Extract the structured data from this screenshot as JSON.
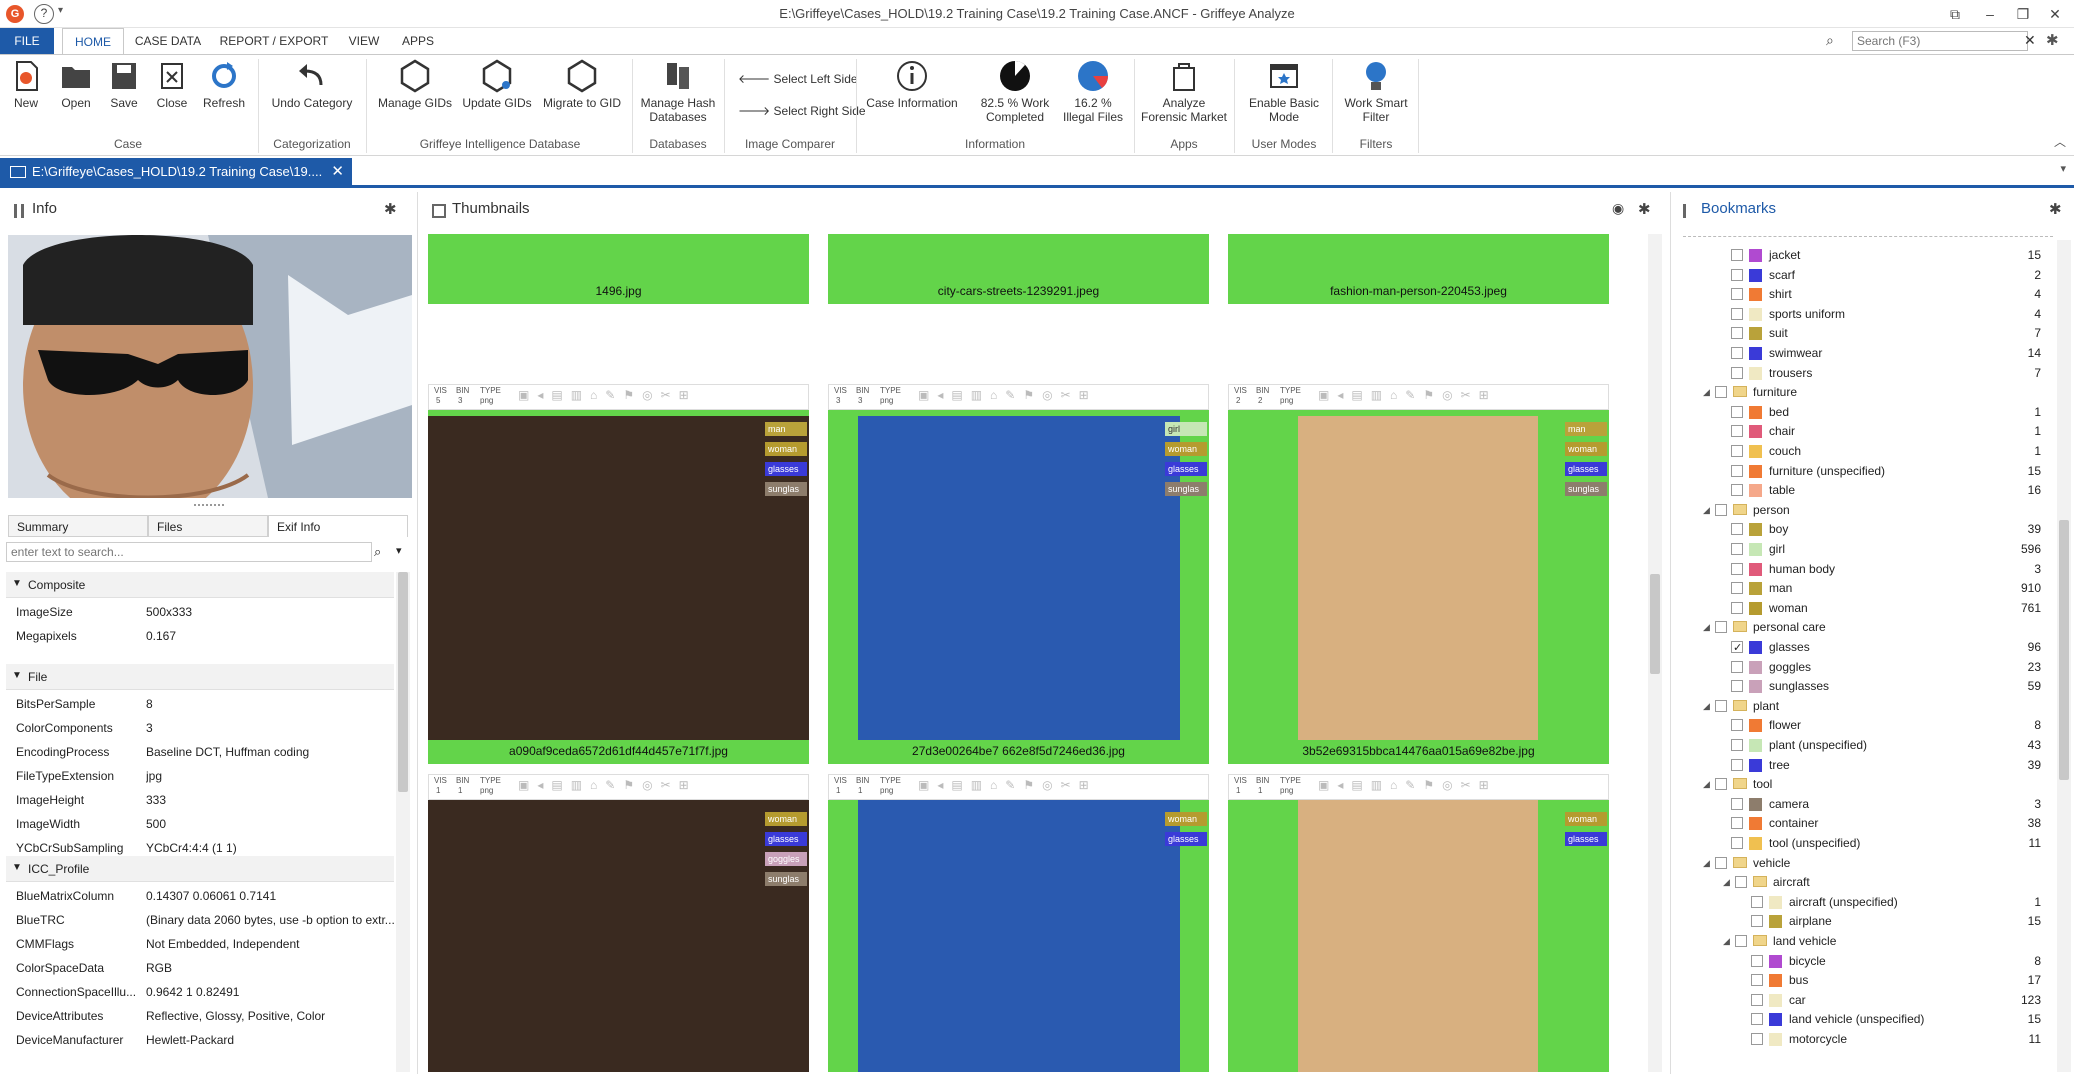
{
  "window": {
    "title": "E:\\Griffeye\\Cases_HOLD\\19.2 Training Case\\19.2 Training Case.ANCF - Griffeye Analyze"
  },
  "menu": {
    "tabs": [
      {
        "label": "FILE"
      },
      {
        "label": "HOME"
      },
      {
        "label": "CASE DATA"
      },
      {
        "label": "REPORT / EXPORT"
      },
      {
        "label": "VIEW"
      },
      {
        "label": "APPS"
      }
    ],
    "search_placeholder": "Search (F3)"
  },
  "ribbon": {
    "buttons": {
      "new": "New",
      "open": "Open",
      "save": "Save",
      "close": "Close",
      "refresh": "Refresh",
      "undo": "Undo Category",
      "manage_gids": "Manage GIDs",
      "update_gids": "Update GIDs",
      "migrate": "Migrate to GID",
      "manage_hash": "Manage Hash Databases",
      "select_left": "Select Left Side",
      "select_right": "Select Right Side",
      "case_info": "Case Information",
      "work_completed": "82.5 % Work Completed",
      "illegal_files": "16.2 % Illegal Files",
      "analyze_forensic": "Analyze Forensic Market",
      "enable_basic": "Enable Basic Mode",
      "work_smart": "Work Smart Filter"
    },
    "groups": {
      "case": "Case",
      "categorization": "Categorization",
      "gid": "Griffeye Intelligence Database",
      "databases": "Databases",
      "comparer": "Image Comparer",
      "information": "Information",
      "apps": "Apps",
      "user_modes": "User Modes",
      "filters": "Filters"
    }
  },
  "doc_tab": {
    "label": "E:\\Griffeye\\Cases_HOLD\\19.2 Training Case\\19...."
  },
  "info": {
    "title": "Info",
    "tabs": {
      "summary": "Summary",
      "files": "Files",
      "exif": "Exif Info"
    },
    "search_placeholder": "enter text to search...",
    "composite_label": "Composite",
    "composite": [
      {
        "k": "ImageSize",
        "v": "500x333"
      },
      {
        "k": "Megapixels",
        "v": "0.167"
      }
    ],
    "file_label": "File",
    "file": [
      {
        "k": "BitsPerSample",
        "v": "8"
      },
      {
        "k": "ColorComponents",
        "v": "3"
      },
      {
        "k": "EncodingProcess",
        "v": "Baseline DCT, Huffman coding"
      },
      {
        "k": "FileTypeExtension",
        "v": "jpg"
      },
      {
        "k": "ImageHeight",
        "v": "333"
      },
      {
        "k": "ImageWidth",
        "v": "500"
      },
      {
        "k": "YCbCrSubSampling",
        "v": "YCbCr4:4:4 (1 1)"
      }
    ],
    "icc_label": "ICC_Profile",
    "icc": [
      {
        "k": "BlueMatrixColumn",
        "v": "0.14307 0.06061 0.7141"
      },
      {
        "k": "BlueTRC",
        "v": "(Binary data 2060 bytes, use -b option to extr..."
      },
      {
        "k": "CMMFlags",
        "v": "Not Embedded, Independent"
      },
      {
        "k": "ColorSpaceData",
        "v": "RGB"
      },
      {
        "k": "ConnectionSpaceIllu...",
        "v": "0.9642 1 0.82491"
      },
      {
        "k": "DeviceAttributes",
        "v": "Reflective, Glossy, Positive, Color"
      },
      {
        "k": "DeviceManufacturer",
        "v": "Hewlett-Packard"
      }
    ]
  },
  "thumbs": {
    "title": "Thumbnails",
    "items": [
      {
        "name": "1496.jpg",
        "tags": []
      },
      {
        "name": "city-cars-streets-1239291.jpeg",
        "tags": []
      },
      {
        "name": "fashion-man-person-220453.jpeg",
        "tags": []
      },
      {
        "name": "a090af9ceda6572d61df44d457e71f7f.jpg",
        "vis": "5",
        "bin": "3",
        "type": "png",
        "tags": [
          "man",
          "woman",
          "glasses",
          "sunglas"
        ]
      },
      {
        "name": "27d3e00264be7  662e8f5d7246ed36.jpg",
        "vis": "3",
        "bin": "3",
        "type": "png",
        "tags": [
          "girl",
          "woman",
          "glasses",
          "sunglas"
        ]
      },
      {
        "name": "3b52e69315bbca14476aa015a69e82be.jpg",
        "vis": "2",
        "bin": "2",
        "type": "png",
        "tags": [
          "man",
          "woman",
          "glasses",
          "sunglas"
        ]
      },
      {
        "name": "",
        "vis": "1",
        "bin": "1",
        "type": "png",
        "tags": [
          "woman",
          "glasses",
          "goggles",
          "sunglas"
        ]
      },
      {
        "name": "",
        "vis": "1",
        "bin": "1",
        "type": "png",
        "tags": [
          "woman",
          "glasses"
        ]
      },
      {
        "name": "",
        "vis": "1",
        "bin": "1",
        "type": "png",
        "tags": [
          "woman",
          "glasses"
        ]
      }
    ],
    "bar_labels": {
      "vis": "VIS",
      "bin": "BIN",
      "type": "TYPE"
    }
  },
  "bookmarks": {
    "title": "Bookmarks",
    "rows": [
      {
        "label": "jacket",
        "count": "15",
        "color": "#b04ad0",
        "level": 2
      },
      {
        "label": "scarf",
        "count": "2",
        "color": "#3a3ad8",
        "level": 2
      },
      {
        "label": "shirt",
        "count": "4",
        "color": "#f07a34",
        "level": 2
      },
      {
        "label": "sports uniform",
        "count": "4",
        "color": "#f0e9c3",
        "level": 2
      },
      {
        "label": "suit",
        "count": "7",
        "color": "#b9a23a",
        "level": 2
      },
      {
        "label": "swimwear",
        "count": "14",
        "color": "#3a3ad8",
        "level": 2
      },
      {
        "label": "trousers",
        "count": "7",
        "color": "#f0e9c3",
        "level": 2
      },
      {
        "label": "furniture",
        "count": "",
        "color": "",
        "level": 1
      },
      {
        "label": "bed",
        "count": "1",
        "color": "#f07a34",
        "level": 2
      },
      {
        "label": "chair",
        "count": "1",
        "color": "#e05a7a",
        "level": 2
      },
      {
        "label": "couch",
        "count": "1",
        "color": "#f0c050",
        "level": 2
      },
      {
        "label": "furniture (unspecified)",
        "count": "15",
        "color": "#f07a34",
        "level": 2
      },
      {
        "label": "table",
        "count": "16",
        "color": "#f5a88a",
        "level": 2
      },
      {
        "label": "person",
        "count": "",
        "color": "",
        "level": 1
      },
      {
        "label": "boy",
        "count": "39",
        "color": "#b9a23a",
        "level": 2
      },
      {
        "label": "girl",
        "count": "596",
        "color": "#c6e7b5",
        "level": 2
      },
      {
        "label": "human body",
        "count": "3",
        "color": "#e05a7a",
        "level": 2
      },
      {
        "label": "man",
        "count": "910",
        "color": "#b9a23a",
        "level": 2
      },
      {
        "label": "woman",
        "count": "761",
        "color": "#b59b2f",
        "level": 2
      },
      {
        "label": "personal care",
        "count": "",
        "color": "",
        "level": 1
      },
      {
        "label": "glasses",
        "count": "96",
        "color": "#3a3ad8",
        "level": 2
      },
      {
        "label": "goggles",
        "count": "23",
        "color": "#c9a1b9",
        "level": 2
      },
      {
        "label": "sunglasses",
        "count": "59",
        "color": "#c9a1b9",
        "level": 2
      },
      {
        "label": "plant",
        "count": "",
        "color": "",
        "level": 1
      },
      {
        "label": "flower",
        "count": "8",
        "color": "#f07a34",
        "level": 2
      },
      {
        "label": "plant (unspecified)",
        "count": "43",
        "color": "#c6e7b5",
        "level": 2
      },
      {
        "label": "tree",
        "count": "39",
        "color": "#3a3ad8",
        "level": 2
      },
      {
        "label": "tool",
        "count": "",
        "color": "",
        "level": 1
      },
      {
        "label": "camera",
        "count": "3",
        "color": "#8d7d6c",
        "level": 2
      },
      {
        "label": "container",
        "count": "38",
        "color": "#f07a34",
        "level": 2
      },
      {
        "label": "tool (unspecified)",
        "count": "11",
        "color": "#f0c050",
        "level": 2
      },
      {
        "label": "vehicle",
        "count": "",
        "color": "",
        "level": 1
      },
      {
        "label": "aircraft",
        "count": "",
        "color": "",
        "level": 2
      },
      {
        "label": "aircraft (unspecified)",
        "count": "1",
        "color": "#f0e9c3",
        "level": 3
      },
      {
        "label": "airplane",
        "count": "15",
        "color": "#b9a23a",
        "level": 3
      },
      {
        "label": "land vehicle",
        "count": "",
        "color": "",
        "level": 2
      },
      {
        "label": "bicycle",
        "count": "8",
        "color": "#b04ad0",
        "level": 3
      },
      {
        "label": "bus",
        "count": "17",
        "color": "#f07a34",
        "level": 3
      },
      {
        "label": "car",
        "count": "123",
        "color": "#f0e9c3",
        "level": 3
      },
      {
        "label": "land vehicle (unspecified)",
        "count": "15",
        "color": "#3a3ad8",
        "level": 3
      },
      {
        "label": "motorcycle",
        "count": "11",
        "color": "#f0e9c3",
        "level": 3
      }
    ]
  },
  "colors": {
    "accent": "#1e5aa8",
    "thumb_green": "#63d44a"
  }
}
